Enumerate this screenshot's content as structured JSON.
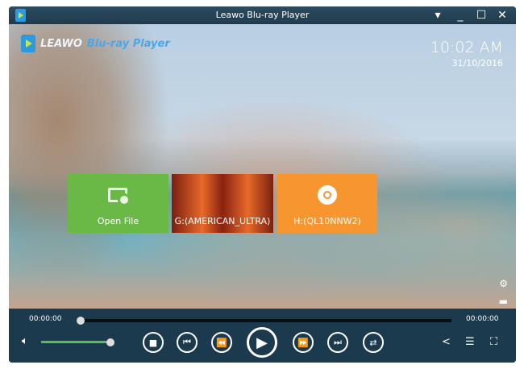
{
  "window": {
    "title": "Leawo Blu-ray Player"
  },
  "logo": {
    "brand": "LEAWO",
    "product": "Blu-ray Player"
  },
  "clock": {
    "time": "10:02 AM",
    "date": "31/10/2016"
  },
  "tiles": [
    {
      "label": "Open File"
    },
    {
      "label": "G:(AMERICAN_ULTRA)"
    },
    {
      "label": "H:(QL10NNW2)"
    }
  ],
  "playback": {
    "elapsed": "00:00:00",
    "total": "00:00:00",
    "progress": 0,
    "volume": 1.0
  },
  "colors": {
    "open_tile": "#6ab946",
    "disc_tile": "#f7952e",
    "control_bar": "#1b3a4d",
    "volume": "#5cb85c"
  }
}
